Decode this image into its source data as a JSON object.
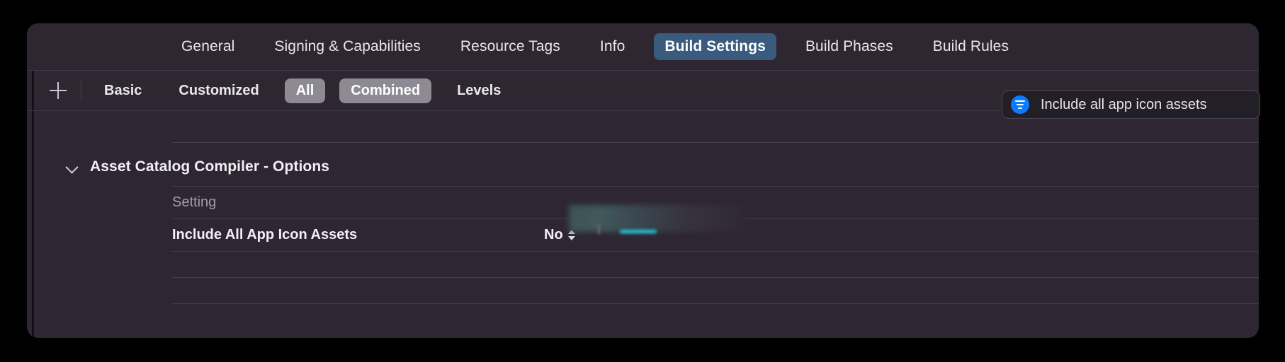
{
  "window": {
    "tabs": [
      {
        "label": "General",
        "selected": false
      },
      {
        "label": "Signing & Capabilities",
        "selected": false
      },
      {
        "label": "Resource Tags",
        "selected": false
      },
      {
        "label": "Info",
        "selected": false
      },
      {
        "label": "Build Settings",
        "selected": true
      },
      {
        "label": "Build Phases",
        "selected": false
      },
      {
        "label": "Build Rules",
        "selected": false
      }
    ]
  },
  "filterbar": {
    "add_button_icon": "plus-icon",
    "segments": [
      {
        "label": "Basic",
        "active": false
      },
      {
        "label": "Customized",
        "active": false
      },
      {
        "label": "All",
        "active": true
      },
      {
        "label": "Combined",
        "active": true
      },
      {
        "label": "Levels",
        "active": false
      }
    ]
  },
  "search": {
    "icon": "filter-icon",
    "value": "Include all app icon assets",
    "placeholder": "Search"
  },
  "table": {
    "group": {
      "title": "Asset Catalog Compiler - Options",
      "expanded": true,
      "disclosure_icon": "chevron-down-icon"
    },
    "rows": [
      {
        "name": "Setting",
        "value": "",
        "redacted": true,
        "bold": false
      },
      {
        "name": "Include All App Icon Assets",
        "value": "No",
        "redacted": false,
        "bold": true,
        "stepper_icon": "chevron-up-down-icon"
      }
    ]
  },
  "colors": {
    "window_background": "#2e2633",
    "toolbar_background": "#2e2732",
    "selected_tab": "#3a5b7e",
    "selected_segment": "#8d8a93",
    "accent_blue": "#0a7cff",
    "separator": "#443d4a",
    "text_primary": "#f2eff4",
    "text_muted": "#a39daa",
    "desktop_background": "#000000"
  }
}
